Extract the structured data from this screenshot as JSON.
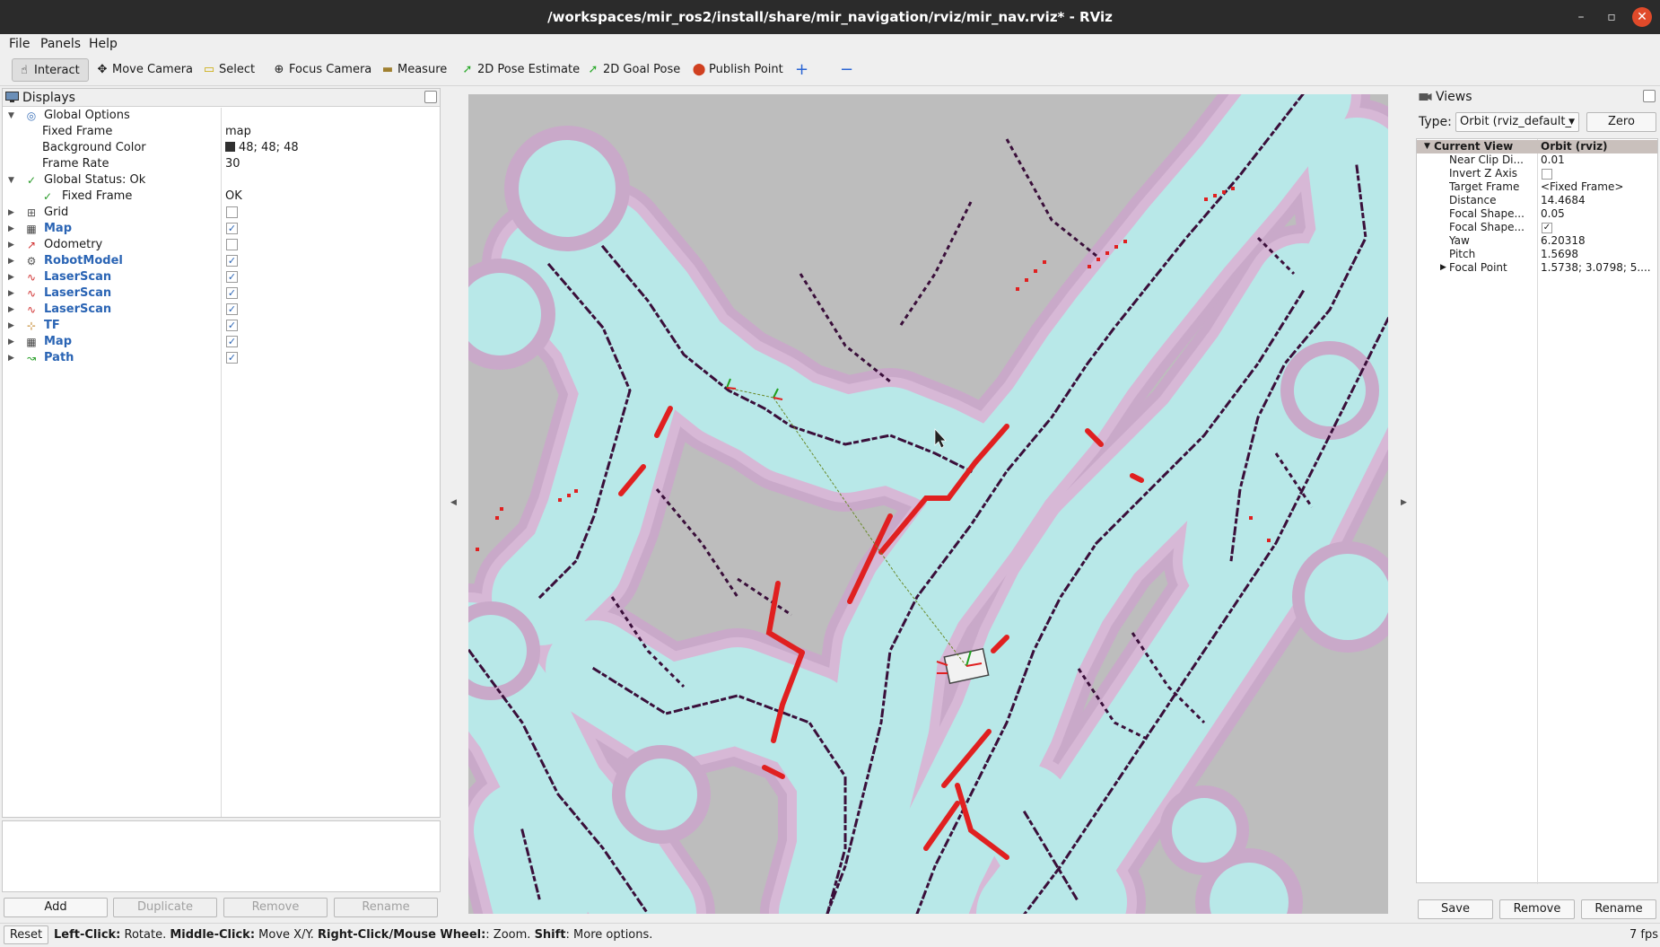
{
  "window": {
    "title": "/workspaces/mir_ros2/install/share/mir_navigation/rviz/mir_nav.rviz* - RViz",
    "minimize": "–",
    "restore": "▫",
    "close": "✕"
  },
  "menu": [
    "File",
    "Panels",
    "Help"
  ],
  "toolbar": {
    "interact": "Interact",
    "move_camera": "Move Camera",
    "select": "Select",
    "focus_camera": "Focus Camera",
    "measure": "Measure",
    "pose_estimate": "2D Pose Estimate",
    "goal_pose": "2D Goal Pose",
    "publish_point": "Publish Point",
    "plus_icon": "+",
    "minus_icon": "−"
  },
  "displays": {
    "title": "Displays",
    "rows": [
      {
        "label": "Global Options",
        "value": "",
        "icon": "◎"
      },
      {
        "label": "Fixed Frame",
        "value": "map"
      },
      {
        "label": "Background Color",
        "value": "48; 48; 48"
      },
      {
        "label": "Frame Rate",
        "value": "30"
      },
      {
        "label": "Global Status: Ok",
        "value": "",
        "icon": "✓"
      },
      {
        "label": "Fixed Frame",
        "value": "OK",
        "icon": "✓"
      },
      {
        "label": "Grid",
        "icon": "⊞"
      },
      {
        "label": "Map",
        "icon": "▦"
      },
      {
        "label": "Odometry",
        "icon": "↗"
      },
      {
        "label": "RobotModel",
        "icon": "⚙"
      },
      {
        "label": "LaserScan",
        "icon": "∿"
      },
      {
        "label": "LaserScan",
        "icon": "∿"
      },
      {
        "label": "LaserScan",
        "icon": "∿"
      },
      {
        "label": "TF",
        "icon": "⊹"
      },
      {
        "label": "Map",
        "icon": "▦"
      },
      {
        "label": "Path",
        "icon": "↝"
      }
    ],
    "check": "✓",
    "buttons": {
      "add": "Add",
      "duplicate": "Duplicate",
      "remove": "Remove",
      "rename": "Rename"
    }
  },
  "views": {
    "title": "Views",
    "type_label": "Type:",
    "type_value": "Orbit (rviz_default_",
    "zero": "Zero",
    "rows": [
      {
        "label": "Current View",
        "value": "Orbit (rviz)"
      },
      {
        "label": "Near Clip Di...",
        "value": "0.01"
      },
      {
        "label": "Invert Z Axis",
        "value": ""
      },
      {
        "label": "Target Frame",
        "value": "<Fixed Frame>"
      },
      {
        "label": "Distance",
        "value": "14.4684"
      },
      {
        "label": "Focal Shape...",
        "value": "0.05"
      },
      {
        "label": "Focal Shape...",
        "value": ""
      },
      {
        "label": "Yaw",
        "value": "6.20318"
      },
      {
        "label": "Pitch",
        "value": "1.5698"
      },
      {
        "label": "Focal Point",
        "value": "1.5738; 3.0798; 5...."
      }
    ],
    "check": "✓",
    "buttons": {
      "save": "Save",
      "remove": "Remove",
      "rename": "Rename"
    }
  },
  "status": {
    "reset": "Reset",
    "l1": "Left-Click:",
    "t1": " Rotate. ",
    "l2": "Middle-Click:",
    "t2": " Move X/Y. ",
    "l3": "Right-Click/Mouse Wheel:",
    "t3": ": Zoom. ",
    "l4": "Shift",
    "t4": ": More options.",
    "fps": "7 fps"
  },
  "colors": {
    "map_free": "#bdbdbd",
    "inflation": "#b8e8e8",
    "halo": "#c9a9c9",
    "obstacle": "#3a0f3a",
    "laser": "#e02020"
  }
}
